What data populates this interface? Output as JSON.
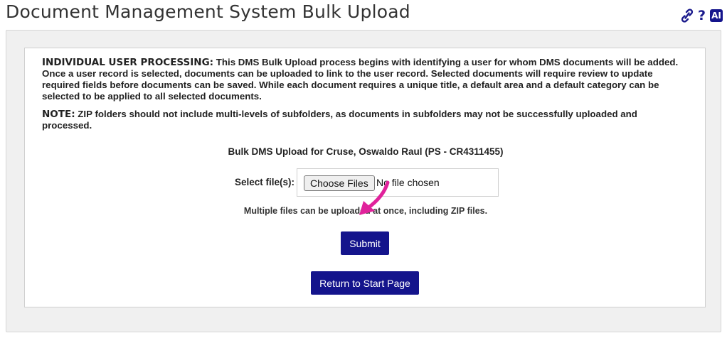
{
  "header": {
    "title": "Document Management System Bulk Upload",
    "icons": [
      "link-icon",
      "help-icon",
      "ai-icon"
    ],
    "help_glyph": "?",
    "ai_label": "AI"
  },
  "instructions": {
    "para1_lead": "INDIVIDUAL USER PROCESSING:",
    "para1_text": " This DMS Bulk Upload process begins with identifying a user for whom DMS documents will be added. Once a user record is selected, documents can be uploaded to link to the user record. Selected documents will require review to update required fields before documents can be saved. While each document requires a unique title, a default area and a default category can be selected to be applied to all selected documents.",
    "para2_lead": "NOTE:",
    "para2_text": " ZIP folders should not include multi-levels of subfolders, as documents in subfolders may not be successfully uploaded and processed."
  },
  "upload": {
    "heading": "Bulk DMS Upload for Cruse, Oswaldo Raul (PS - CR4311455)",
    "select_label": "Select file(s):",
    "choose_button": "Choose Files",
    "no_file_text": "No file chosen",
    "hint": "Multiple files can be uploaded at once, including ZIP files."
  },
  "actions": {
    "submit_label": "Submit",
    "return_label": "Return to Start Page"
  },
  "colors": {
    "accent": "#14148c",
    "annotation_arrow": "#e0229b"
  }
}
